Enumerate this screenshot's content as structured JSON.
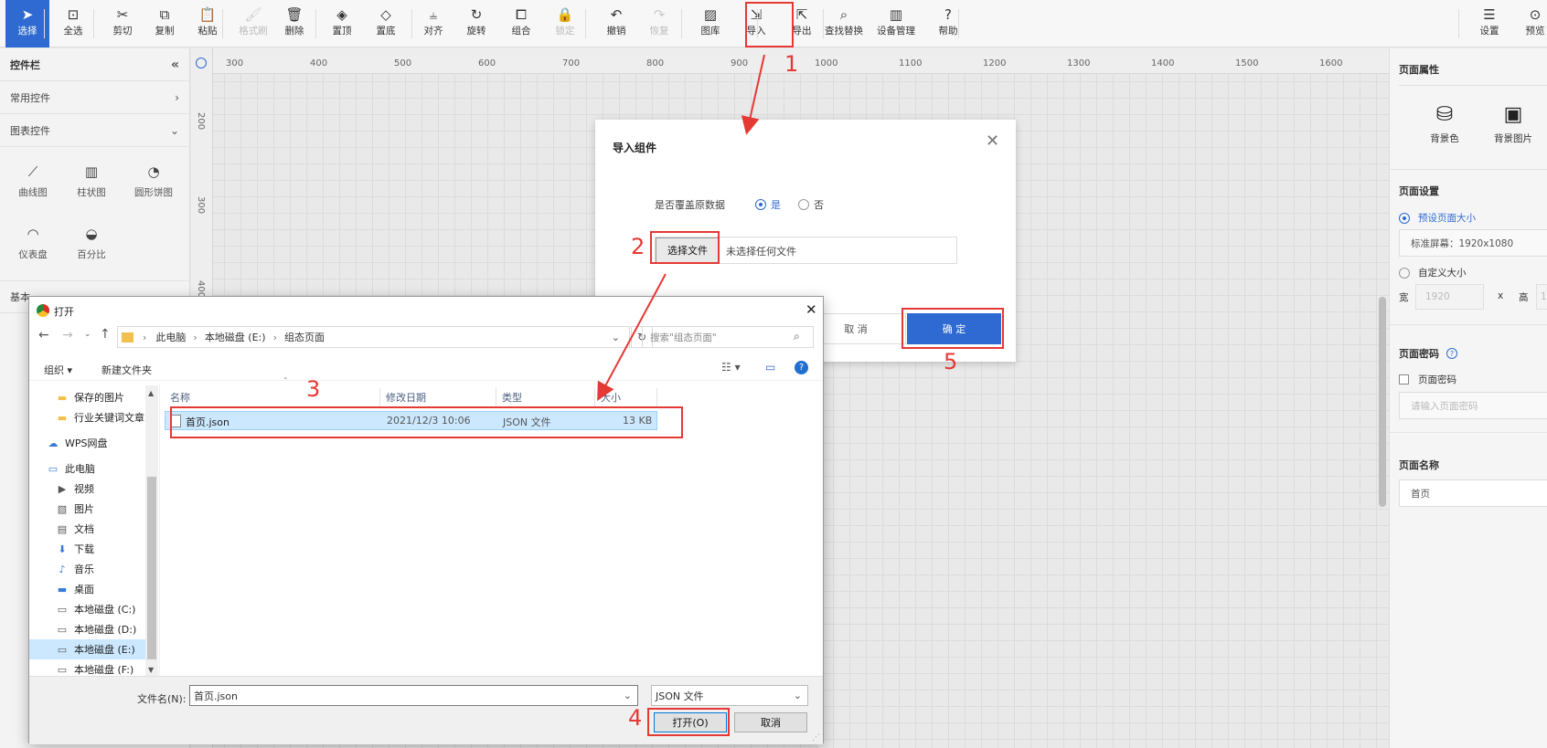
{
  "toolbar": {
    "items": [
      {
        "label": "选择",
        "icon": "cursor-icon",
        "state": "active"
      },
      {
        "label": "全选",
        "icon": "select-all-icon",
        "state": "normal"
      },
      {
        "label": "剪切",
        "icon": "scissors-icon",
        "state": "normal"
      },
      {
        "label": "复制",
        "icon": "copy-icon",
        "state": "normal"
      },
      {
        "label": "粘贴",
        "icon": "paste-icon",
        "state": "normal"
      },
      {
        "label": "格式刷",
        "icon": "format-brush-icon",
        "state": "disabled"
      },
      {
        "label": "删除",
        "icon": "trash-icon",
        "state": "normal"
      },
      {
        "label": "置顶",
        "icon": "bring-front-icon",
        "state": "normal"
      },
      {
        "label": "置底",
        "icon": "send-back-icon",
        "state": "normal"
      },
      {
        "label": "对齐",
        "icon": "align-icon",
        "state": "normal"
      },
      {
        "label": "旋转",
        "icon": "rotate-icon",
        "state": "normal"
      },
      {
        "label": "组合",
        "icon": "group-icon",
        "state": "normal"
      },
      {
        "label": "锁定",
        "icon": "lock-icon",
        "state": "disabled"
      },
      {
        "label": "撤销",
        "icon": "undo-icon",
        "state": "normal"
      },
      {
        "label": "恢复",
        "icon": "redo-icon",
        "state": "disabled"
      },
      {
        "label": "图库",
        "icon": "gallery-icon",
        "state": "normal"
      },
      {
        "label": "导入",
        "icon": "import-icon",
        "state": "normal"
      },
      {
        "label": "导出",
        "icon": "export-icon",
        "state": "normal"
      },
      {
        "label": "查找替换",
        "icon": "find-replace-icon",
        "state": "normal"
      },
      {
        "label": "设备管理",
        "icon": "device-manage-icon",
        "state": "normal"
      },
      {
        "label": "帮助",
        "icon": "help-icon",
        "state": "normal"
      },
      {
        "label": "设置",
        "icon": "settings-icon",
        "state": "normal"
      },
      {
        "label": "预览",
        "icon": "preview-icon",
        "state": "normal"
      }
    ]
  },
  "left_panel": {
    "title": "控件栏",
    "sections": [
      "常用控件",
      "图表控件"
    ],
    "chart_items": [
      {
        "label": "曲线图",
        "icon": "line-chart-icon"
      },
      {
        "label": "柱状图",
        "icon": "bar-chart-icon"
      },
      {
        "label": "圆形饼图",
        "icon": "pie-chart-icon"
      },
      {
        "label": "仪表盘",
        "icon": "gauge-icon"
      },
      {
        "label": "百分比",
        "icon": "percent-icon"
      }
    ],
    "basic_label": "基本"
  },
  "ruler": {
    "h_ticks": [
      "300",
      "400",
      "500",
      "600",
      "700",
      "800",
      "900",
      "1000",
      "1100",
      "1200",
      "1300",
      "1400",
      "1500",
      "1600"
    ],
    "v_ticks": [
      "200",
      "300",
      "400"
    ]
  },
  "right_panel": {
    "page_props": "页面属性",
    "bg_color": "背景色",
    "bg_image": "背景图片",
    "page_settings": "页面设置",
    "preset_size": "预设页面大小",
    "preset_value": "标准屏幕：1920x1080",
    "custom_size": "自定义大小",
    "width_label": "宽",
    "width_value": "1920",
    "x_label": "x",
    "height_label": "高",
    "height_value": "1",
    "page_password_title": "页面密码",
    "page_password_chk": "页面密码",
    "password_placeholder": "请输入页面密码",
    "page_name_title": "页面名称",
    "page_name_value": "首页"
  },
  "import_dialog": {
    "title": "导入组件",
    "overwrite_label": "是否覆盖原数据",
    "opt_yes": "是",
    "opt_no": "否",
    "choose_file": "选择文件",
    "no_file": "未选择任何文件",
    "cancel": "取 消",
    "confirm": "确 定"
  },
  "file_dialog": {
    "title": "打开",
    "path": [
      "此电脑",
      "本地磁盘 (E:)",
      "组态页面"
    ],
    "search_placeholder": "搜索\"组态页面\"",
    "organize": "组织 ▾",
    "new_folder": "新建文件夹",
    "nav": [
      {
        "label": "保存的图片",
        "icon": "folder-icon",
        "indent": 1
      },
      {
        "label": "行业关键词文章",
        "icon": "folder-icon",
        "indent": 1
      },
      {
        "label": "WPS网盘",
        "icon": "cloud-icon",
        "indent": 0
      },
      {
        "label": "此电脑",
        "icon": "computer-icon",
        "indent": 0
      },
      {
        "label": "视频",
        "icon": "video-icon",
        "indent": 1
      },
      {
        "label": "图片",
        "icon": "pictures-icon",
        "indent": 1
      },
      {
        "label": "文档",
        "icon": "documents-icon",
        "indent": 1
      },
      {
        "label": "下载",
        "icon": "download-icon",
        "indent": 1
      },
      {
        "label": "音乐",
        "icon": "music-icon",
        "indent": 1
      },
      {
        "label": "桌面",
        "icon": "desktop-icon",
        "indent": 1
      },
      {
        "label": "本地磁盘 (C:)",
        "icon": "drive-icon",
        "indent": 1
      },
      {
        "label": "本地磁盘 (D:)",
        "icon": "drive-icon",
        "indent": 1
      },
      {
        "label": "本地磁盘 (E:)",
        "icon": "drive-icon",
        "indent": 1,
        "selected": true
      },
      {
        "label": "本地磁盘 (F:)",
        "icon": "drive-icon",
        "indent": 1
      }
    ],
    "columns": [
      "名称",
      "修改日期",
      "类型",
      "大小"
    ],
    "files": [
      {
        "name": "首页.json",
        "date": "2021/12/3 10:06",
        "type": "JSON 文件",
        "size": "13 KB"
      }
    ],
    "filename_label": "文件名(N):",
    "filename_value": "首页.json",
    "filetype_value": "JSON 文件",
    "open": "打开(O)",
    "cancel": "取消"
  },
  "annotations": [
    "1",
    "2",
    "3",
    "4",
    "5"
  ],
  "colors": {
    "accent": "#2e6ad1",
    "annotation": "#e53935"
  }
}
